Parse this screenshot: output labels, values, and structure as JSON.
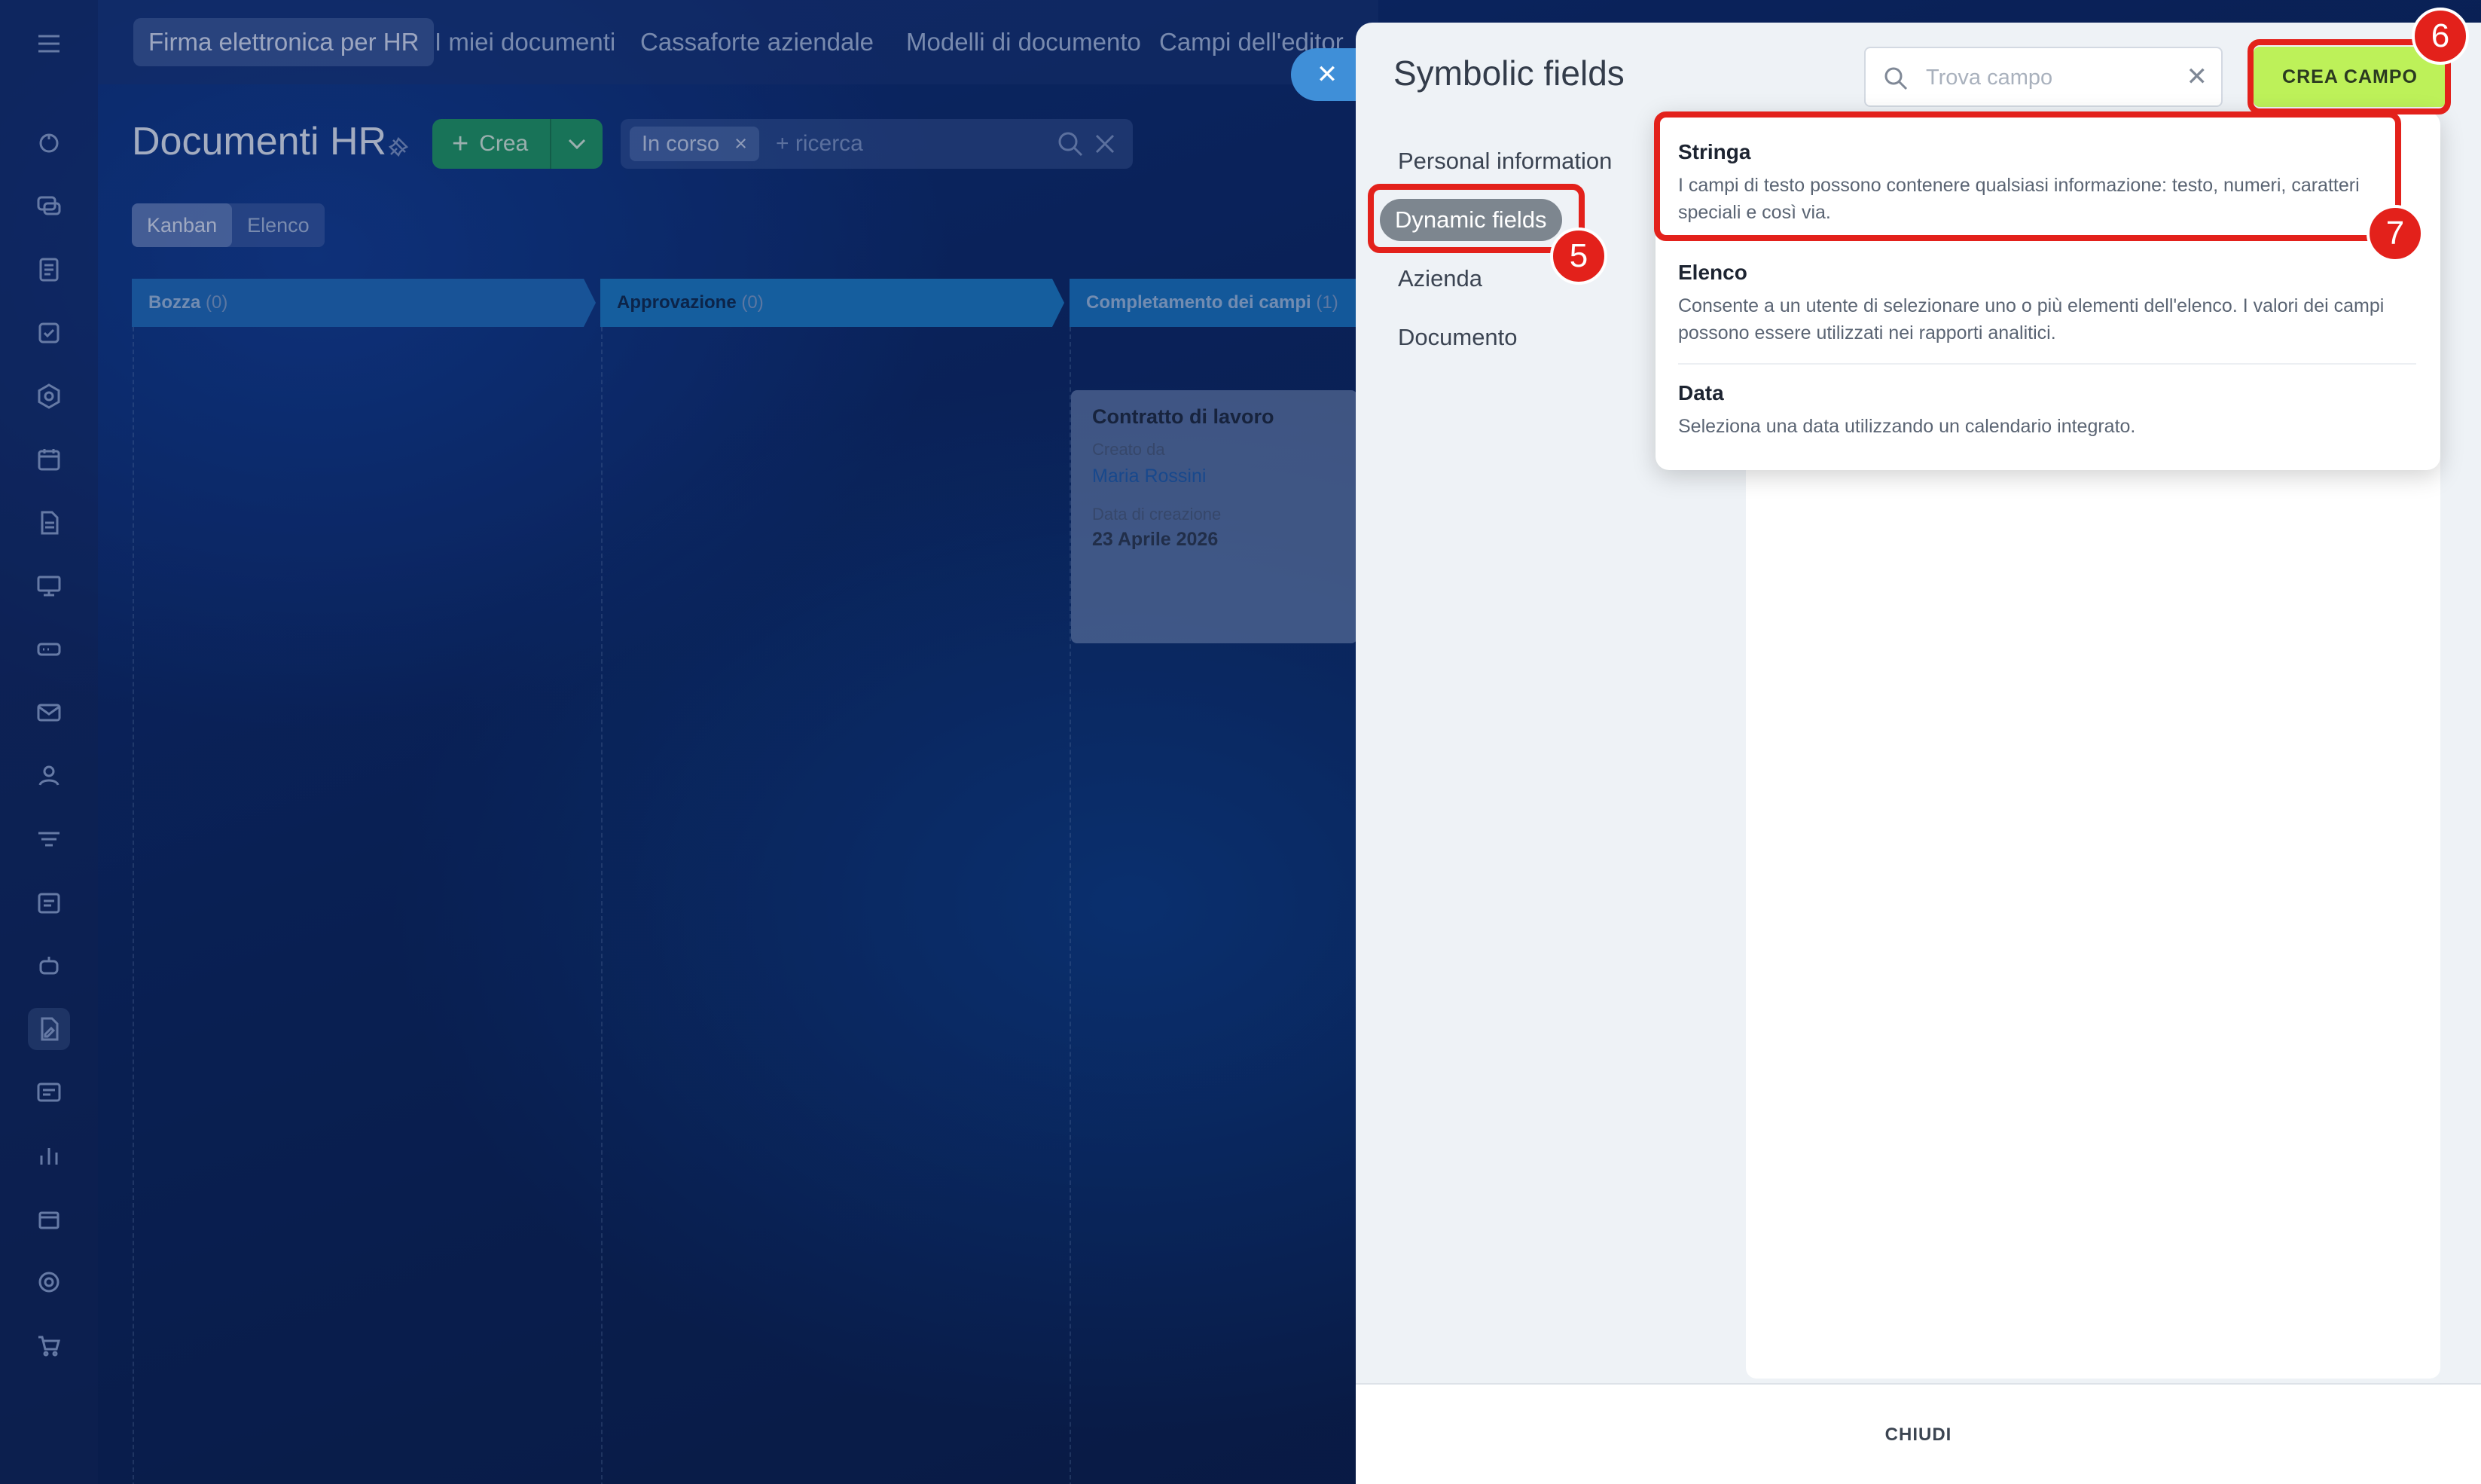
{
  "app": {
    "nav": {
      "items": [
        {
          "label": "Firma elettronica per HR",
          "active": true
        },
        {
          "label": "I miei documenti"
        },
        {
          "label": "Cassaforte aziendale"
        },
        {
          "label": "Modelli di documento"
        },
        {
          "label": "Campi dell'editor"
        }
      ]
    },
    "page_title": "Documenti HR",
    "create_button": "Crea",
    "filter": {
      "chip": "In corso",
      "placeholder": "+ ricerca"
    },
    "view_tabs": {
      "kanban": "Kanban",
      "list": "Elenco"
    },
    "columns": [
      {
        "title": "Bozza",
        "count": "(0)",
        "color": "#1f6fc4"
      },
      {
        "title": "Approvazione",
        "count": "(0)",
        "color": "#1b7fcf"
      },
      {
        "title": "Completamento dei campi",
        "count": "(1)",
        "color": "#1876c9"
      }
    ],
    "card": {
      "title": "Contratto di lavoro",
      "created_by_label": "Creato da",
      "created_by": "Maria Rossini",
      "date_label": "Data di creazione",
      "date": "23 Aprile 2026"
    }
  },
  "panel": {
    "title": "Symbolic fields",
    "search": {
      "placeholder": "Trova campo"
    },
    "create_button": "CREA CAMPO",
    "categories": {
      "personal": "Personal information",
      "dynamic": "Dynamic fields",
      "company": "Azienda",
      "document": "Documento"
    },
    "dropdown": {
      "items": [
        {
          "name": "Stringa",
          "desc": "I campi di testo possono contenere qualsiasi informazione: testo, numeri, caratteri speciali e così via."
        },
        {
          "name": "Elenco",
          "desc": "Consente a un utente di selezionare uno o più elementi dell'elenco. I valori dei campi possono essere utilizzati nei rapporti analitici."
        },
        {
          "name": "Data",
          "desc": "Seleziona una data utilizzando un calendario integrato."
        }
      ]
    },
    "close_button": "CHIUDI"
  },
  "annotations": {
    "step5": "5",
    "step6": "6",
    "step7": "7"
  },
  "colors": {
    "accent_green": "#bdf159",
    "highlight_red": "#e3211b",
    "create_green": "#1f9d6b"
  }
}
